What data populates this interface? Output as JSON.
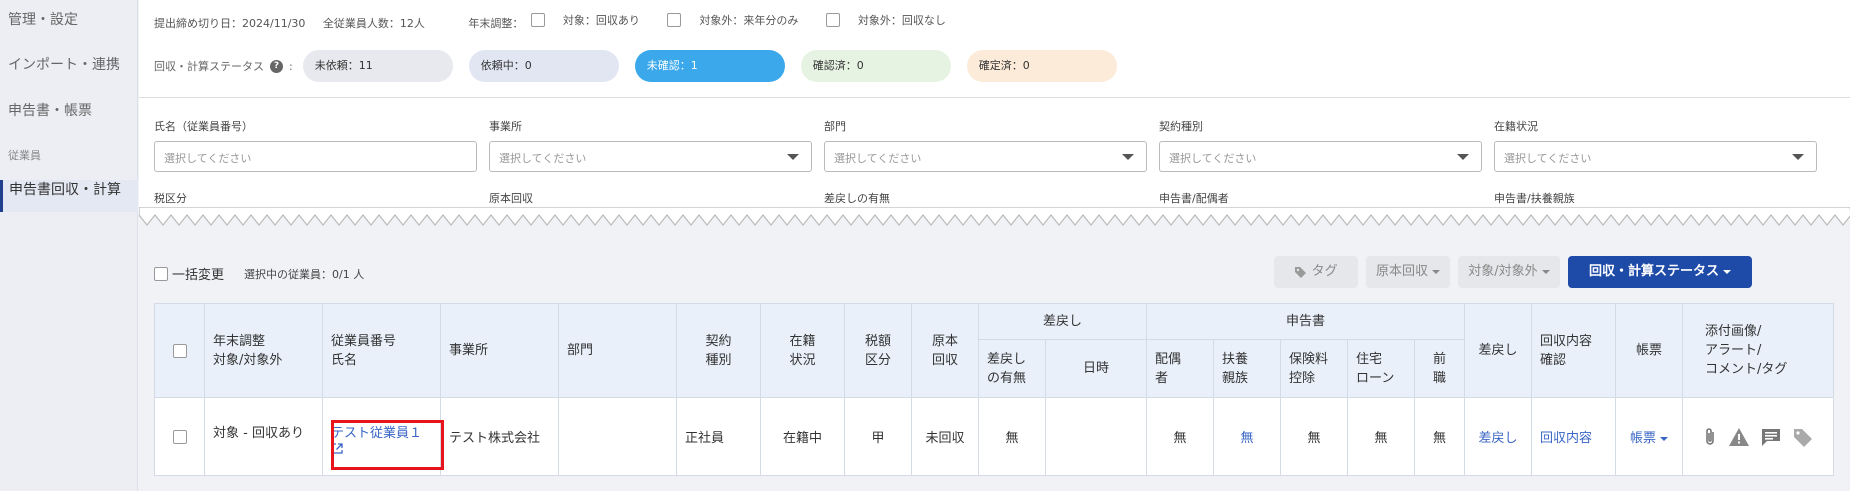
{
  "sidebar": {
    "items": [
      {
        "label": "管理・設定"
      },
      {
        "label": "インポート・連携"
      },
      {
        "label": "申告書・帳票"
      }
    ],
    "section_label": "従業員",
    "active_item": "申告書回収・計算"
  },
  "header": {
    "deadline": "提出締め切り日：2024/11/30",
    "total_employees": "全従業員人数：12人",
    "year_end_label": "年末調整：",
    "options": [
      "対象：回収あり",
      "対象外：来年分のみ",
      "対象外：回収なし"
    ]
  },
  "status": {
    "label": "回収・計算ステータス",
    "pills": [
      {
        "label": "未依頼：11",
        "bg": "#e8e9ee",
        "fg": "#333333"
      },
      {
        "label": "依頼中：0",
        "bg": "#e2e6f3",
        "fg": "#333333"
      },
      {
        "label": "未確認：1",
        "bg": "#3aa8ea",
        "fg": "#ffffff"
      },
      {
        "label": "確認済：0",
        "bg": "#e7f3e2",
        "fg": "#333333"
      },
      {
        "label": "確定済：0",
        "bg": "#fcebd9",
        "fg": "#333333"
      }
    ]
  },
  "filters": {
    "placeholder": "選択してください",
    "fields": [
      "氏名（従業員番号）",
      "事業所",
      "部門",
      "契約種別",
      "在籍状況"
    ],
    "fields2": [
      "税区分",
      "原本回収",
      "差戻しの有無",
      "申告書/配偶者",
      "申告書/扶養親族"
    ]
  },
  "toolbar": {
    "bulk_label": "一括変更",
    "selected_count": "選択中の従業員：0/1 人",
    "tag_button": "タグ",
    "original_button": "原本回収",
    "target_button": "対象/対象外",
    "status_button": "回収・計算ステータス"
  },
  "table": {
    "headers": {
      "year_end": "年末調整\n対象/対象外",
      "emp": "従業員番号\n氏名",
      "office": "事業所",
      "dept": "部門",
      "contract": "契約\n種別",
      "enroll": "在籍\n状況",
      "tax": "税額\n区分",
      "original": "原本\n回収",
      "remand_group": "差戻し",
      "remand_has": "差戻し\nの有無",
      "remand_date": "日時",
      "form_group": "申告書",
      "spouse": "配偶\n者",
      "dependent": "扶養\n親族",
      "insurance": "保険料\n控除",
      "housing": "住宅\nローン",
      "prev_job": "前\n職",
      "remand": "差戻し",
      "confirm": "回収内容\n確認",
      "forms": "帳票",
      "attach": "添付画像/\nアラート/\nコメント/タグ"
    },
    "row": {
      "year_end": "対象 - 回収あり",
      "emp_name": "テスト従業員１",
      "office": "テスト株式会社",
      "dept": "",
      "contract": "正社員",
      "enroll": "在籍中",
      "tax": "甲",
      "original": "未回収",
      "remand_has": "無",
      "remand_date": "",
      "spouse": "無",
      "dependent": "無",
      "insurance": "無",
      "housing": "無",
      "prev_job": "無",
      "remand": "差戻し",
      "confirm": "回収内容",
      "forms": "帳票"
    }
  }
}
